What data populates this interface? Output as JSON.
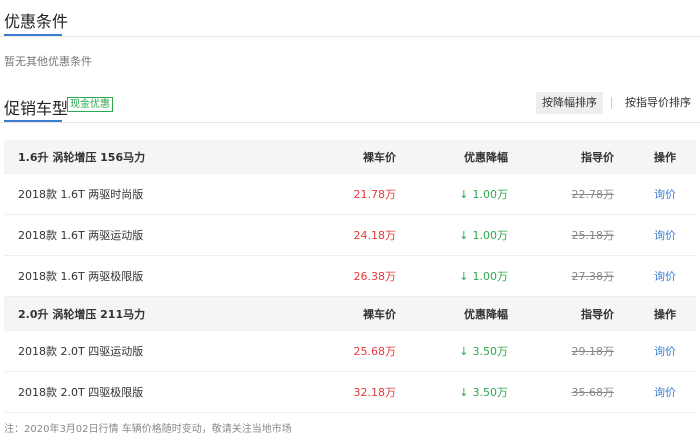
{
  "promo_conditions": {
    "title": "优惠条件",
    "empty_text": "暂无其他优惠条件"
  },
  "promo_models": {
    "title": "促销车型",
    "badge": "现金优惠",
    "sort_by_discount": "按降幅排序",
    "sort_by_guide_price": "按指导价排序"
  },
  "groups": [
    {
      "engine": "1.6升 涡轮增压 156马力",
      "headers": {
        "price": "裸车价",
        "discount": "优惠降幅",
        "guide": "指导价",
        "action": "操作"
      },
      "rows": [
        {
          "name": "2018款 1.6T 两驱时尚版",
          "price": "21.78万",
          "discount": "1.00万",
          "guide": "22.78万",
          "action": "询价"
        },
        {
          "name": "2018款 1.6T 两驱运动版",
          "price": "24.18万",
          "discount": "1.00万",
          "guide": "25.18万",
          "action": "询价"
        },
        {
          "name": "2018款 1.6T 两驱极限版",
          "price": "26.38万",
          "discount": "1.00万",
          "guide": "27.38万",
          "action": "询价"
        }
      ]
    },
    {
      "engine": "2.0升 涡轮增压 211马力",
      "headers": {
        "price": "裸车价",
        "discount": "优惠降幅",
        "guide": "指导价",
        "action": "操作"
      },
      "rows": [
        {
          "name": "2018款 2.0T 四驱运动版",
          "price": "25.68万",
          "discount": "3.50万",
          "guide": "29.18万",
          "action": "询价"
        },
        {
          "name": "2018款 2.0T 四驱极限版",
          "price": "32.18万",
          "discount": "3.50万",
          "guide": "35.68万",
          "action": "询价"
        }
      ]
    }
  ],
  "discount_arrow": "↓",
  "footnote": "注：2020年3月02日行情 车辆价格随时变动，敬请关注当地市场",
  "colors": {
    "accent": "#3b7ed0",
    "price": "#e5383b",
    "discount": "#2da84f"
  }
}
